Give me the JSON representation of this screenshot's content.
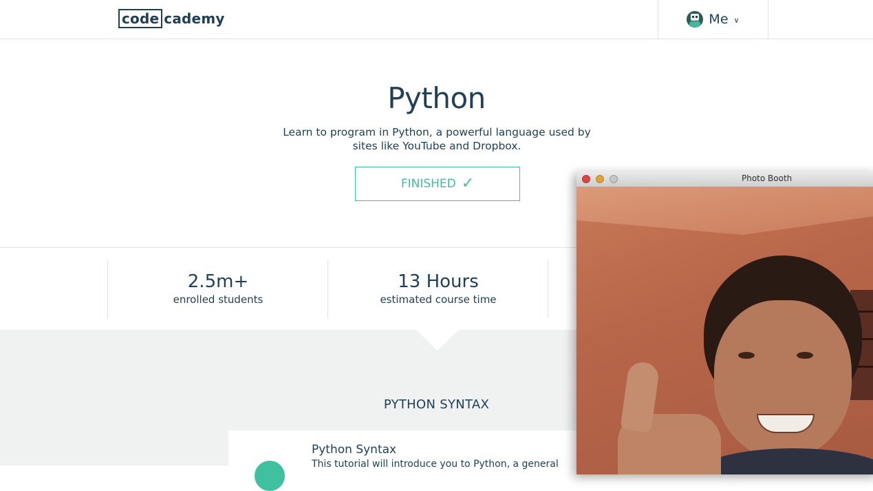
{
  "header": {
    "logo_boxed": "code",
    "logo_rest": "cademy",
    "user_menu_label": "Me"
  },
  "hero": {
    "title": "Python",
    "description": "Learn to program in Python, a powerful language used by sites like YouTube and Dropbox.",
    "status_button": "FINISHED",
    "status_icon": "check-icon"
  },
  "stats": [
    {
      "value": "2.5m+",
      "label": "enrolled students"
    },
    {
      "value": "13 Hours",
      "label": "estimated course time"
    }
  ],
  "syllabus": {
    "section_title": "PYTHON SYNTAX",
    "unit": {
      "title": "Python Syntax",
      "description": "This tutorial will introduce you to Python, a general"
    }
  },
  "photo_booth": {
    "window_title": "Photo Booth"
  },
  "colors": {
    "accent": "#3fc1a0",
    "text": "#204056",
    "section_bg": "#f0f2f2"
  }
}
